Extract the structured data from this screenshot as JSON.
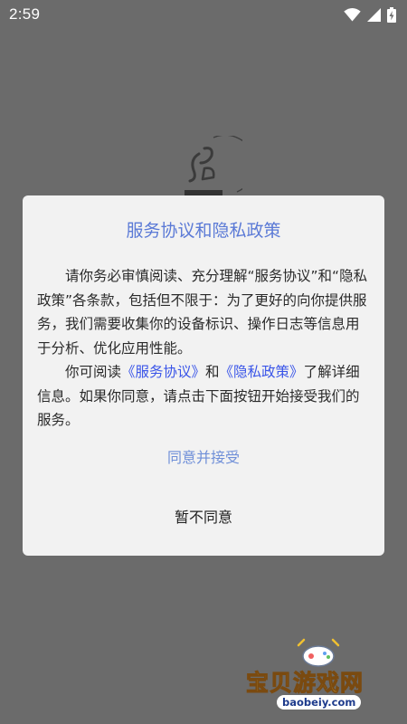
{
  "status_bar": {
    "time": "2:59"
  },
  "icons": {
    "wifi": "wifi-icon",
    "signal": "signal-icon",
    "battery": "battery-charging-icon",
    "app_logo": "app-logo-icon",
    "gamepad": "gamepad-icon"
  },
  "dialog": {
    "title": "服务协议和隐私政策",
    "paragraph1": "请你务必审慎阅读、充分理解“服务协议”和“隐私政策”各条款，包括但不限于：为了更好的向你提供服务，我们需要收集你的设备标识、操作日志等信息用于分析、优化应用性能。",
    "paragraph2_prefix": "你可阅读",
    "service_link": "《服务协议》",
    "paragraph2_and": "和",
    "privacy_link": "《隐私政策》",
    "paragraph2_suffix": "了解详细信息。如果你同意，请点击下面按钮开始接受我们的服务。",
    "agree_label": "同意并接受",
    "disagree_label": "暂不同意"
  },
  "watermark": {
    "brand": "宝贝游戏网",
    "url": "baobeiy.com"
  },
  "colors": {
    "overlay_background": "#6b6b6b",
    "dialog_background": "#f2f2f2",
    "title": "#5b7ad6",
    "link": "#3a55e8",
    "agree": "#6f8fd8"
  }
}
